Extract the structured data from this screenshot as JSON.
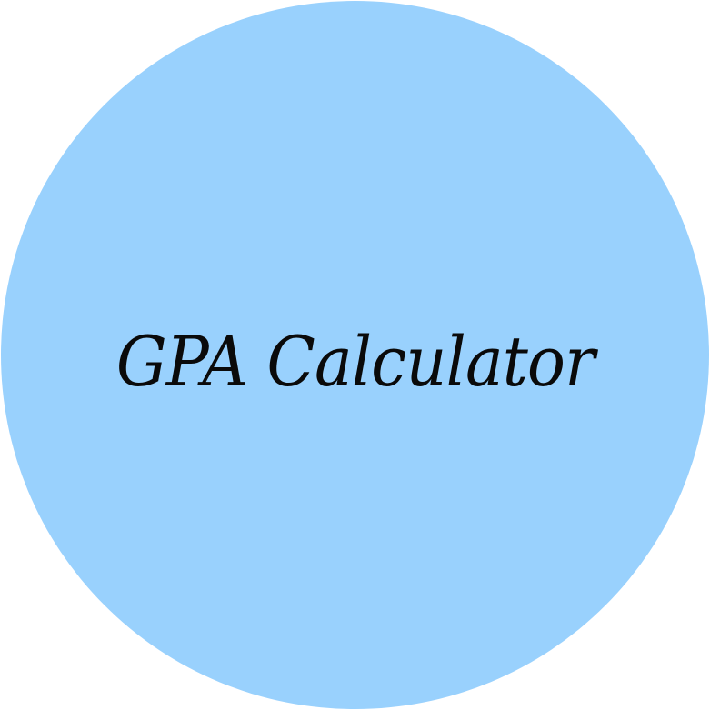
{
  "title": "GPA Calculator",
  "colors": {
    "background": "#ffffff",
    "circle": "#99d1fd",
    "text": "#0a0a0a"
  }
}
